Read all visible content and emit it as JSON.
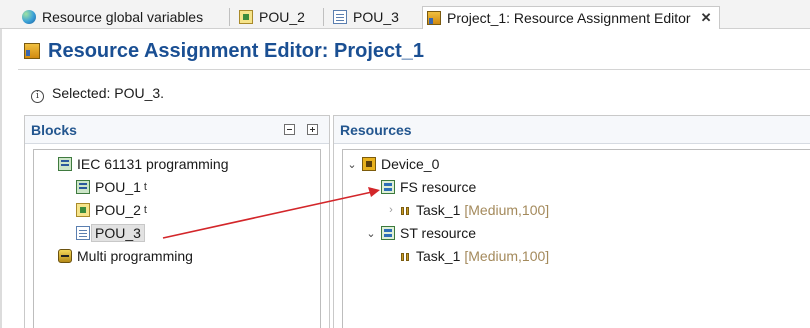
{
  "tabs": [
    {
      "label": "Resource global variables",
      "icon": "globe-icon"
    },
    {
      "label": "POU_2",
      "icon": "fbd-pou-icon"
    },
    {
      "label": "POU_3",
      "icon": "st-pou-icon"
    },
    {
      "label": "Project_1: Resource Assignment Editor",
      "icon": "resource-editor-icon",
      "active": true,
      "close": "✕"
    }
  ],
  "editor": {
    "title": "Resource Assignment Editor: Project_1",
    "status": "Selected: POU_3.",
    "info_glyph": "i"
  },
  "blocks": {
    "title": "Blocks",
    "tree": {
      "root": "IEC 61131 programming",
      "items": [
        {
          "label": "POU_1",
          "suffix": "t"
        },
        {
          "label": "POU_2",
          "suffix": "t"
        },
        {
          "label": "POU_3",
          "suffix": "",
          "selected": true
        }
      ],
      "second_root": "Multi programming"
    }
  },
  "resources": {
    "title": "Resources",
    "device": "Device_0",
    "fs_resource": {
      "label": "FS resource",
      "task": "Task_1",
      "meta": "[Medium,100]"
    },
    "st_resource": {
      "label": "ST resource",
      "task": "Task_1",
      "meta": "[Medium,100]"
    }
  },
  "glyphs": {
    "expanded": "⌄",
    "collapsed": "›"
  },
  "colors": {
    "title": "#1a4f93",
    "panel_title": "#23568f",
    "drag_arrow": "#d3262a",
    "task_meta": "#a48a5c"
  }
}
